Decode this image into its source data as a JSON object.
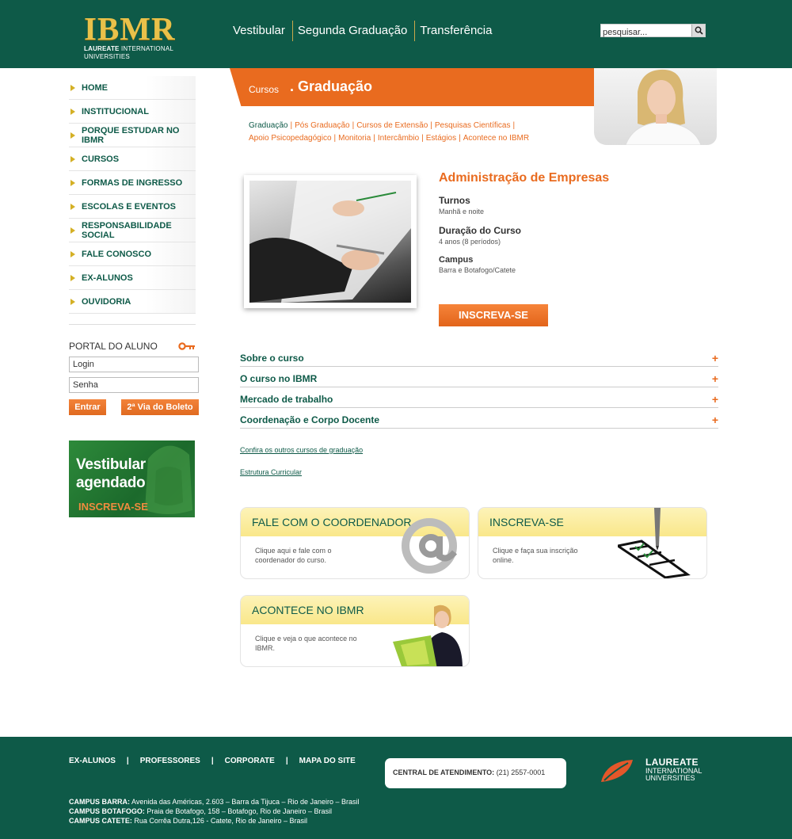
{
  "header": {
    "logo_text": "IBMR",
    "logo_sub_bold": "LAUREATE",
    "logo_sub_rest": "INTERNATIONAL UNIVERSITIES",
    "nav": [
      "Vestibular",
      "Segunda Graduação",
      "Transferência"
    ],
    "search_placeholder": "pesquisar..."
  },
  "sidebar": {
    "items": [
      {
        "label": "HOME"
      },
      {
        "label": "INSTITUCIONAL"
      },
      {
        "label": "PORQUE ESTUDAR NO IBMR"
      },
      {
        "label": "CURSOS"
      },
      {
        "label": "FORMAS DE INGRESSO"
      },
      {
        "label": "ESCOLAS E EVENTOS"
      },
      {
        "label": "RESPONSABILIDADE SOCIAL"
      },
      {
        "label": "FALE CONOSCO"
      },
      {
        "label": "EX-ALUNOS"
      },
      {
        "label": "OUVIDORIA"
      }
    ],
    "portal": {
      "title": "PORTAL DO ALUNO",
      "login_value": "Login",
      "password_value": "Senha",
      "enter_label": "Entrar",
      "boleto_label": "2ª Via do Boleto"
    },
    "banner": {
      "line1": "Vestibular",
      "line2": "agendado",
      "line3": "INSCREVA-SE"
    }
  },
  "band": {
    "small": "Cursos",
    "big": ". Graduação"
  },
  "subnav": [
    {
      "label": "Graduação",
      "color": "green"
    },
    {
      "label": "Pós Graduação",
      "color": "orange"
    },
    {
      "label": "Cursos de Extensão",
      "color": "orange"
    },
    {
      "label": "Pesquisas Científicas",
      "color": "orange"
    },
    {
      "label": "Apoio Psicopedagógico",
      "color": "orange"
    },
    {
      "label": "Monitoria",
      "color": "orange"
    },
    {
      "label": "Intercâmbio",
      "color": "orange"
    },
    {
      "label": "Estágios",
      "color": "orange"
    },
    {
      "label": "Acontece no IBMR",
      "color": "orange"
    }
  ],
  "course": {
    "title": "Administração de Empresas",
    "turnos_label": "Turnos",
    "turnos_value": "Manhã e noite",
    "duracao_label": "Duração do Curso",
    "duracao_value": "4 anos (8 períodos)",
    "campus_label": "Campus",
    "campus_value": "Barra e Botafogo/Catete",
    "subscribe_label": "INSCREVA-SE"
  },
  "accordion": [
    {
      "label": "Sobre o curso"
    },
    {
      "label": "O curso no IBMR"
    },
    {
      "label": "Mercado de trabalho"
    },
    {
      "label": "Coordenação e Corpo Docente"
    }
  ],
  "accordion_plus": "+",
  "links": {
    "outros": "Confira os outros cursos de graduação",
    "estrutura": "Estrutura Curricular"
  },
  "boxes": {
    "coord": {
      "title": "FALE COM O COORDENADOR",
      "text": "Clique aqui e fale com o coordenador do curso."
    },
    "inscreva": {
      "title": "INSCREVA-SE",
      "text": "Clique e faça sua inscrição online."
    },
    "acontece": {
      "title": "ACONTECE NO IBMR",
      "text": "Clique e veja o que acontece no IBMR."
    }
  },
  "footer": {
    "nav": [
      "EX-ALUNOS",
      "PROFESSORES",
      "CORPORATE",
      "MAPA DO SITE"
    ],
    "nav_sep": "|",
    "central_label": "CENTRAL DE ATENDIMENTO:",
    "central_phone": "(21) 2557-0001",
    "laureate_line1": "LAUREATE",
    "laureate_line2": "INTERNATIONAL",
    "laureate_line3": "UNIVERSITIES",
    "campi": [
      {
        "name": "CAMPUS BARRA:",
        "addr": "Avenida das Américas, 2.603 – Barra da Tijuca – Rio de Janeiro – Brasil"
      },
      {
        "name": "CAMPUS BOTAFOGO:",
        "addr": "Praia de Botafogo, 158 – Botafogo, Rio de Janeiro – Brasil"
      },
      {
        "name": "CAMPUS CATETE:",
        "addr": "Rua Corrêa Dutra,126 - Catete, Rio de Janeiro – Brasil"
      }
    ]
  },
  "colors": {
    "green": "#0e5a48",
    "orange": "#e96b1f",
    "gold": "#e9c14a"
  },
  "icons": [
    "search-icon",
    "arrow-bullet-icon",
    "key-icon",
    "plus-icon",
    "at-sign-icon",
    "pen-checklist-icon",
    "laureate-leaf-icon"
  ]
}
